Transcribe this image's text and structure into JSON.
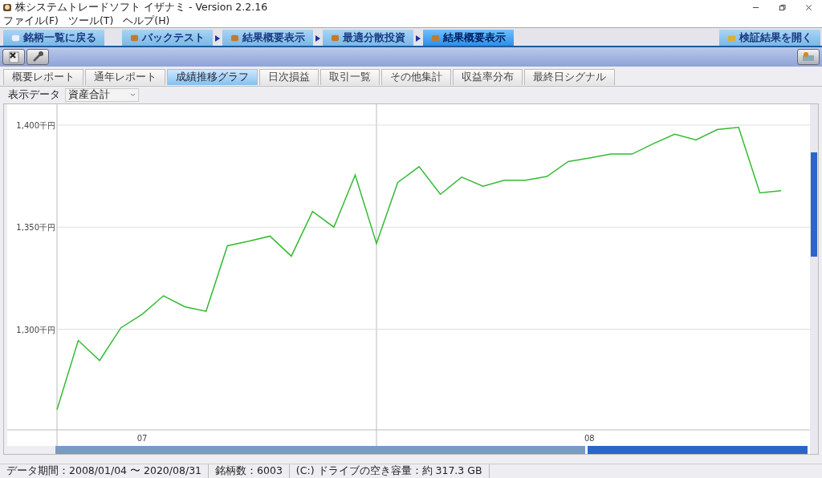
{
  "window": {
    "title": "株システムトレードソフト イザナミ - Version 2.2.16"
  },
  "menu": [
    "ファイル(F)",
    "ツール(T)",
    "ヘルプ(H)"
  ],
  "nav_tabs": [
    {
      "label": "銘柄一覧に戻る",
      "selected": false,
      "arrow": false
    },
    {
      "label": "バックテスト",
      "selected": false,
      "arrow": false
    },
    {
      "label": "結果概要表示",
      "selected": false,
      "arrow": true
    },
    {
      "label": "最適分散投資",
      "selected": false,
      "arrow": true
    },
    {
      "label": "結果概要表示",
      "selected": true,
      "arrow": true
    }
  ],
  "open_button": {
    "label": "検証結果を開く"
  },
  "sub_tabs": [
    {
      "label": "概要レポート",
      "selected": false
    },
    {
      "label": "通年レポート",
      "selected": false
    },
    {
      "label": "成績推移グラフ",
      "selected": true
    },
    {
      "label": "日次損益",
      "selected": false
    },
    {
      "label": "取引一覧",
      "selected": false
    },
    {
      "label": "その他集計",
      "selected": false
    },
    {
      "label": "収益率分布",
      "selected": false
    },
    {
      "label": "最終日シグナル",
      "selected": false
    }
  ],
  "display": {
    "label": "表示データ",
    "value": "資産合計"
  },
  "chart_data": {
    "type": "line",
    "categories": [
      null,
      null,
      null,
      null,
      "07",
      null,
      null,
      null,
      null,
      null,
      null,
      null,
      null,
      null,
      null,
      null,
      null,
      null,
      null,
      null,
      null,
      null,
      null,
      null,
      null,
      "08",
      null,
      null,
      null,
      null,
      null,
      null,
      null,
      null,
      null
    ],
    "series": [
      {
        "color": "#33bb33",
        "values": [
          1260.6,
          1294.5,
          1284.7,
          1300.7,
          1307.3,
          1316.4,
          1311.0,
          1308.8,
          1340.9,
          1343.1,
          1345.6,
          1335.8,
          1357.7,
          1350.0,
          1375.5,
          1342.0,
          1371.9,
          1379.6,
          1366.1,
          1374.5,
          1370.1,
          1373.0,
          1373.0,
          1374.8,
          1382.1,
          1383.9,
          1385.8,
          1385.8,
          1390.9,
          1395.6,
          1392.7,
          1397.8,
          1398.9,
          1366.8,
          1367.9
        ]
      }
    ],
    "ylim": [
      1250.7,
      1410.2
    ],
    "grid": true,
    "yticks": [
      {
        "value": 1300,
        "label": "1,300千円"
      },
      {
        "value": 1350,
        "label": "1,350千円"
      },
      {
        "value": 1400,
        "label": "1,400千円"
      }
    ]
  },
  "status_bar": [
    "データ期間：2008/01/04 〜 2020/08/31",
    "銘柄数：6003",
    "(C:) ドライブの空き容量：約 317.3 GB"
  ]
}
